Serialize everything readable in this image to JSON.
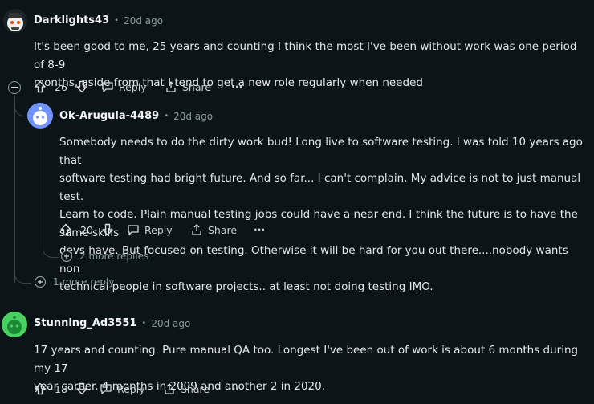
{
  "comments": [
    {
      "username": "Darklights43",
      "time": "20d ago",
      "body_lines": [
        "It's been good to me, 25 years and counting I think the most I've been without work was one period of 8-9",
        "months, aside from that I tend to get a new role regularly when needed"
      ],
      "votes": "26",
      "reply_label": "Reply",
      "share_label": "Share",
      "more_label": "···",
      "more_replies": "1 more reply"
    },
    {
      "username": "Ok-Arugula-4489",
      "time": "20d ago",
      "body_lines": [
        "Somebody needs to do the dirty work bud! Long live to software testing. I was told 10 years ago that",
        "software testing had bright future. And so far... I can't complain. My advice is not to just manual test.",
        "Learn to code. Plain manual testing jobs could have a near end. I think the future is to have the same skills",
        "devs have. But focused on testing. Otherwise it will be hard for you out there....nobody wants non",
        "technical people in software projects.. at least not doing testing IMO."
      ],
      "votes": "20",
      "reply_label": "Reply",
      "share_label": "Share",
      "more_label": "···",
      "more_replies": "2 more replies"
    },
    {
      "username": "Stunning_Ad3551",
      "time": "20d ago",
      "body_lines": [
        "17 years and counting. Pure manual QA too. Longest I've been out of work is about 6 months during my 17",
        "year career. 4 months in 2009 and another 2 in 2020."
      ],
      "votes": "18",
      "reply_label": "Reply",
      "share_label": "Share",
      "more_label": "···"
    }
  ],
  "separator": "•",
  "colors": {
    "background": "#0b1416",
    "thread_line": "#3a4448",
    "avatar_green": "#46d160",
    "avatar_blue": "#7193ff"
  }
}
